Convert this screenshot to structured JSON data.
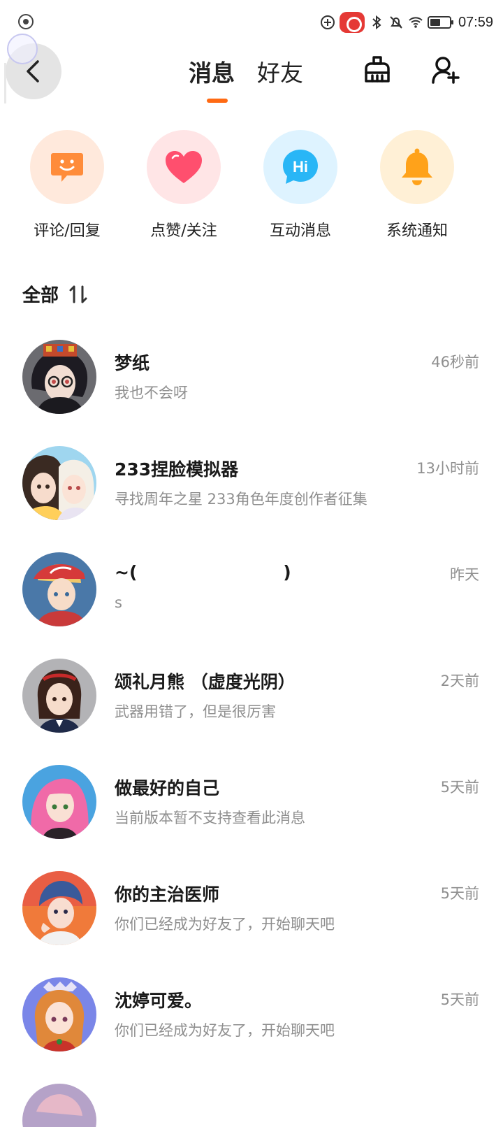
{
  "status_bar": {
    "time": "07:59",
    "battery_level": 0.55,
    "icons": [
      "screen-record-icon",
      "add-circle-icon",
      "recording-icon",
      "bluetooth-icon",
      "mute-icon",
      "wifi-icon",
      "battery-icon"
    ]
  },
  "header": {
    "tabs": [
      {
        "label": "消息",
        "active": true
      },
      {
        "label": "好友",
        "active": false
      }
    ],
    "accent_color": "#ff6a13",
    "icons": [
      "back-arrow-icon",
      "broom-icon",
      "add-friend-icon"
    ]
  },
  "quick_actions": [
    {
      "label": "评论/回复",
      "icon": "comment-smile-icon",
      "bg": "#ffe9dc",
      "fg": "#ff8c3a"
    },
    {
      "label": "点赞/关注",
      "icon": "heart-icon",
      "bg": "#ffe5e6",
      "fg": "#ff4f6e"
    },
    {
      "label": "互动消息",
      "icon": "hi-bubble-icon",
      "bg": "#def3ff",
      "fg": "#29b6f6",
      "icon_text": "Hi"
    },
    {
      "label": "系统通知",
      "icon": "bell-icon",
      "bg": "#fff0d6",
      "fg": "#ffa21a"
    }
  ],
  "section": {
    "title": "全部",
    "sort_icon": "sort-icon"
  },
  "messages": [
    {
      "name": "梦纸",
      "preview": "我也不会呀",
      "time": "46秒前",
      "avatar": "avatar-girl-glasses"
    },
    {
      "name": "233捏脸模拟器",
      "preview": "寻找周年之星 233角色年度创作者征集",
      "time": "13小时前",
      "avatar": "avatar-two-girls"
    },
    {
      "name": "~(                        )",
      "preview": "s",
      "time": "昨天",
      "avatar": "avatar-boy-red-cap"
    },
    {
      "name": "颂礼月熊 （虚度光阴）",
      "preview": "武器用错了，但是很厉害",
      "time": "2天前",
      "avatar": "avatar-girl-headband"
    },
    {
      "name": "做最好的自己",
      "preview": "当前版本暂不支持查看此消息",
      "time": "5天前",
      "avatar": "avatar-pink-hair"
    },
    {
      "name": "你的主治医师",
      "preview": "你们已经成为好友了，开始聊天吧",
      "time": "5天前",
      "avatar": "avatar-blue-hair-boy"
    },
    {
      "name": "沈婷可爱。",
      "preview": "你们已经成为好友了，开始聊天吧",
      "time": "5天前",
      "avatar": "avatar-orange-hair-girl"
    }
  ]
}
